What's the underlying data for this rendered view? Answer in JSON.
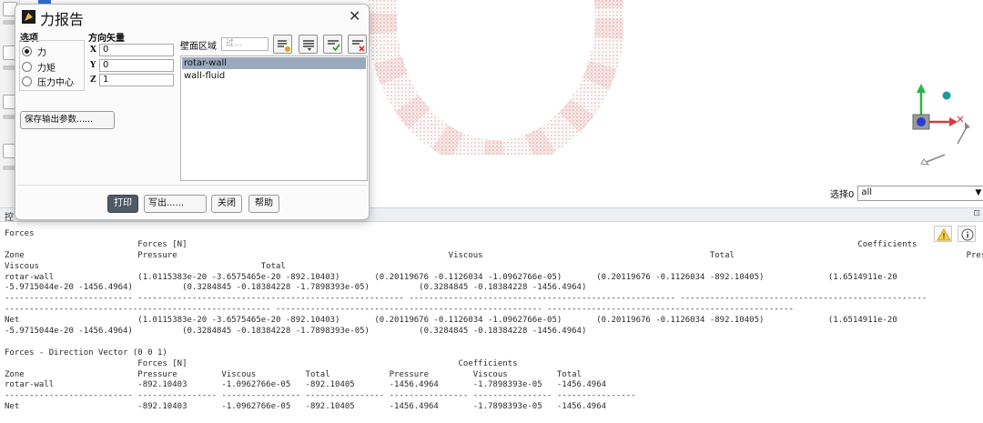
{
  "viewport": {
    "selection_label": "选择0",
    "selection_value": "all"
  },
  "dialog": {
    "title": "力报告",
    "close_glyph": "✕",
    "options_label": "选项",
    "options": [
      {
        "label": "力",
        "selected": true
      },
      {
        "label": "力矩",
        "selected": false
      },
      {
        "label": "压力中心",
        "selected": false
      }
    ],
    "direction_label": "方向矢量",
    "direction": [
      {
        "axis": "X",
        "value": "0"
      },
      {
        "axis": "Y",
        "value": "0"
      },
      {
        "axis": "Z",
        "value": "1"
      }
    ],
    "zones_label": "壁面区域",
    "filter_placeholder": "过…",
    "zones": [
      {
        "name": "rotar-wall",
        "selected": true
      },
      {
        "name": "wall-fluid",
        "selected": false
      }
    ],
    "save_button": "保存输出参数......",
    "buttons": {
      "print": "打印",
      "write": "写出......",
      "close": "关闭",
      "help": "帮助"
    }
  },
  "console": {
    "title": "控",
    "lines": [
      "Forces",
      "                           Forces [N]                                                                                                                                        Coefficients",
      "Zone                       Pressure                                                       Viscous                                              Total                                               Pressure",
      "Viscous                                             Total",
      "rotar-wall                 (1.0115383e-20 -3.6575465e-20 -892.10403)       (0.20119676 -0.1126034 -1.0962766e-05)       (0.20119676 -0.1126034 -892.10405)             (1.6514911e-20",
      "-5.9715044e-20 -1456.4964)          (0.3284845 -0.18384228 -1.7898393e-05)          (0.3284845 -0.18384228 -1456.4964)",
      "-------------------------- ------------------------------------------------------ ------------------------------------------------------ --------------------------------------------------",
      "------------------------------------------------------ ------------------------------------------------------ --------------------------------------------------",
      "Net                        (1.0115383e-20 -3.6575465e-20 -892.10403)       (0.20119676 -0.1126034 -1.0962766e-05)       (0.20119676 -0.1126034 -892.10405)             (1.6514911e-20",
      "-5.9715044e-20 -1456.4964)          (0.3284845 -0.18384228 -1.7898393e-05)          (0.3284845 -0.18384228 -1456.4964)",
      "",
      "Forces - Direction Vector (0 0 1)",
      "                           Forces [N]                                                       Coefficients",
      "Zone                       Pressure         Viscous          Total            Pressure         Viscous          Total",
      "rotar-wall                 -892.10403       -1.0962766e-05   -892.10405       -1456.4964       -1.7898393e-05   -1456.4964",
      "-------------------------- ---------------- ---------------- ---------------- ---------------- ---------------- ----------------",
      "Net                        -892.10403       -1.0962766e-05   -892.10405       -1456.4964       -1.7898393e-05   -1456.4964"
    ]
  },
  "colors": {
    "accent_blue": "#2f6fd6",
    "selection_bg": "#9aaabd",
    "primary_button": "#505a66",
    "ring_points": "#d98c8c"
  }
}
